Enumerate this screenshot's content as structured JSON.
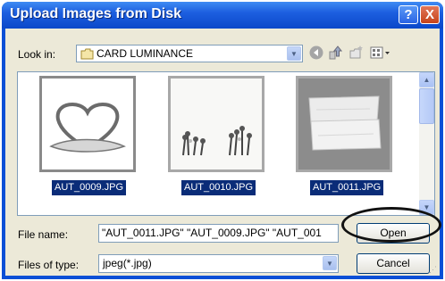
{
  "window": {
    "title": "Upload Images from Disk"
  },
  "titlebar": {
    "help_label": "?",
    "close_label": "X"
  },
  "lookin": {
    "label": "Look in:",
    "value": "CARD LUMINANCE",
    "dropdown_glyph": "▼"
  },
  "toolbar": {
    "back_icon": "back-icon",
    "up_icon": "up-folder-icon",
    "new_icon": "new-folder-icon",
    "view_icon": "views-menu-icon"
  },
  "files": [
    {
      "name": "AUT_0009.JPG",
      "image": "heart-frame"
    },
    {
      "name": "AUT_0010.JPG",
      "image": "flowers"
    },
    {
      "name": "AUT_0011.JPG",
      "image": "wooden-sign"
    }
  ],
  "filename": {
    "label": "File name:",
    "value": "\"AUT_0011.JPG\" \"AUT_0009.JPG\" \"AUT_001"
  },
  "filetype": {
    "label": "Files of type:",
    "value": "jpeg(*.jpg)"
  },
  "buttons": {
    "open": "Open",
    "cancel": "Cancel"
  },
  "colors": {
    "selection": "#0a2c78",
    "titlebar": "#0b47c9",
    "highlight_oval": "#111111"
  }
}
